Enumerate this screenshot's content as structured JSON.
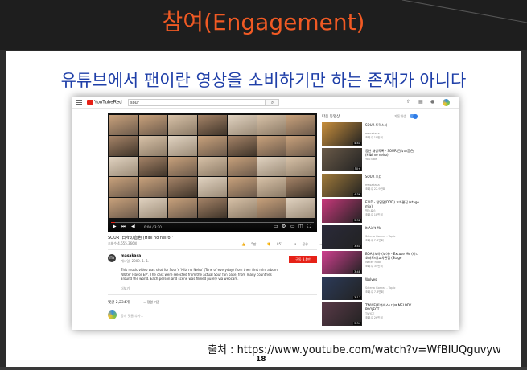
{
  "slide": {
    "title": "참여(Engagement)",
    "subtitle": "유튜브에서 팬이란 영상을 소비하기만 하는 존재가 아니다",
    "source": "출처 : https://www.youtube.com/watch?v=WfBIUQguvyw",
    "page_number": "18",
    "title_color": "#f15a24",
    "subtitle_color": "#1f3fa8"
  },
  "youtube": {
    "logo": "YouTubeRed",
    "search_value": "sour",
    "video": {
      "title": "SOUR '日々の音色 (Hibi no neiro)'",
      "views": "조회수 4,655,366회",
      "time": "0:00 / 3:20",
      "progress": 0.02,
      "actions": [
        "5만",
        "851",
        "공유",
        "···"
      ]
    },
    "channel": {
      "avatar_letter": "m",
      "name": "masakasa",
      "date": "게시일: 2009. 1. 1.",
      "subscribe": "구독 3.6만",
      "description": "This music video was shot for Sour's 'Hibi no Neiro' (Tone of everyday) from their first mini album 'Water Flavor EP'. The cast were selected from the actual Sour fan base, from many countries around the world. Each person and scene was filmed purely via webcam.",
      "more": "더보기"
    },
    "comments": {
      "count": "댓글 2,234개",
      "sort": "정렬 기준",
      "placeholder": "공개 댓글 추가..."
    },
    "sidebar": {
      "header": "다음 동영상",
      "autoplay": "자동재생",
      "items": [
        {
          "title": "SOUR 트릭스터",
          "channel": "masakasa",
          "views": "조회수 18만회",
          "duration": "4:41",
          "color": "#c98f3c"
        },
        {
          "title": "공연 재생목록 - SOUR 日々の音色 (Hibi no neiro)",
          "channel": "YouTube",
          "views": "",
          "duration": "50+",
          "color": "#6a5a48"
        },
        {
          "title": "SOUR 半月",
          "channel": "masakasa",
          "views": "조회수 22.9만회",
          "duration": "4:36",
          "color": "#a07a3a"
        },
        {
          "title": "EXID - 덜덜덜(DDD) 교차편집 (stage mix)",
          "channel": "박스로스",
          "views": "조회수 18만회",
          "duration": "3:38",
          "color": "#c7387a"
        },
        {
          "title": "It Ain't Me",
          "channel": "Selena Gomez - Topic",
          "views": "조회수 7.6만회",
          "duration": "3:41",
          "color": "#2a2a3a"
        },
        {
          "title": "BOA (보아)(보아) - Excuse Me (비디오파르티)교차편집 (Stage",
          "channel": "Water Road",
          "views": "조회수 34만회",
          "duration": "3:48",
          "color": "#d03f8f"
        },
        {
          "title": "Wolves",
          "channel": "Selena Gomez - Topic",
          "views": "조회수 7.8만회",
          "duration": "3:17",
          "color": "#2c3b5a"
        },
        {
          "title": "TWICE(트와이스) 대표 MELODY PROJECT",
          "channel": "TWICE",
          "views": "조회수 26만회",
          "duration": "3:34",
          "color": "#5a3a48"
        }
      ]
    }
  }
}
